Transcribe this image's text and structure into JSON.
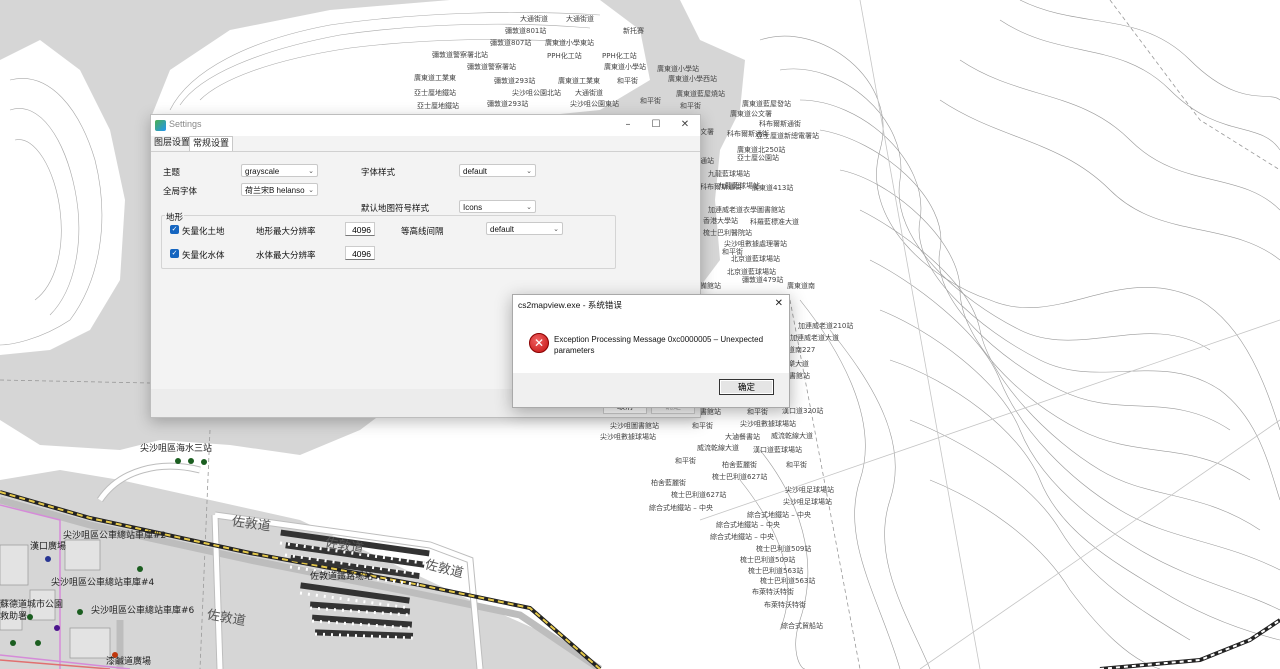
{
  "map": {
    "labels_top": [
      "大通街道",
      "大通街道",
      "彌敦道801站",
      "彌敦道807站",
      "廣東道小學東站",
      "新托賽",
      "彌敦道警察署北站",
      "PPH化工站",
      "彌敦道警察署站",
      "PPH化工站",
      "廣東道小學站",
      "廣東道小學站",
      "廣東道工業東",
      "彌敦道293站",
      "廣東道工業東",
      "和平街",
      "廣東道小學西站",
      "亞士厘地鐵站",
      "尖沙咀公園北站",
      "大通街道",
      "廣東道藍屋燒站",
      "亞士厘地鐵站",
      "彌敦道293站",
      "尖沙咀公園東站",
      "和平街",
      "和平街",
      "廣東道藍屋發站",
      "綜合式地鐵站",
      "中央"
    ],
    "labels_right": [
      "廣東道公文署",
      "科布爾斯通街",
      "文署",
      "科布爾斯通街",
      "亞士厘道新總電署站",
      "廣東道北250站",
      "亞士厘公園站",
      "通站",
      "九龍藍球場站",
      "九龍藍球場站",
      "科布爾斯通街",
      "廣東道413站",
      "加連威老道衣學圖書館站",
      "香港大學站",
      "科羅藍標准大道",
      "梳士巴利醫院站",
      "尖沙咀數據處理署站",
      "和平街",
      "北京道藍球場站",
      "北京道藍球場站",
      "彌敦道479站",
      "廣東道南",
      "備館站",
      "加連威老道210站",
      "加連威老道大道",
      "道南227",
      "樂大道",
      "書館站"
    ],
    "labels_bottom": [
      "書館站",
      "和平街",
      "漢口道320站",
      "尖沙咀圖書館站",
      "和平街",
      "尖沙咀數據球場站",
      "尖沙咀數據球場站",
      "大滷餐書站",
      "威流乾線大道",
      "威流乾線大道",
      "漢口道藍球場站",
      "和平街",
      "柏舍藍麗街",
      "和平街",
      "梳士巴利道627站",
      "尖沙咀足球場站",
      "柏舍藍麗街",
      "梳士巴利道627站",
      "尖沙咀足球場站",
      "綜合式地鐵站 – 中央",
      "綜合式地鐵站 – 中央",
      "綜合式地鐵站 – 中央",
      "綜合式地鐵站 – 中央",
      "梳士巴利道509站",
      "梳士巴利道509站",
      "梳士巴利道563站",
      "梳士巴利道563站",
      "布萊特沃特街",
      "布萊特沃特街",
      "綜合式貿船站"
    ],
    "labels_bottom_left": [
      "尖沙咀區海水三站",
      "尖沙咀區公車總站車庫#2",
      "漢口廣場",
      "尖沙咀區公車總站車庫#4",
      "蘇德道城市公園",
      "救助署",
      "尖沙咀區公車總站車庫#6",
      "漆鹹道廣場",
      "佐敦道鐵路場站"
    ],
    "road_labels": [
      "佐敦道",
      "佐敦道",
      "佐敦道",
      "佐敦道"
    ]
  },
  "settings": {
    "title": "Settings",
    "tabs": [
      "图层设置",
      "常规设置"
    ],
    "active_tab": "常规设置",
    "theme_label": "主题",
    "theme_value": "grayscale",
    "global_font_label": "全局字体",
    "global_font_value": "荷兰宋B helanso",
    "font_style_label": "字体样式",
    "font_style_value": "default",
    "default_symbol_label": "默认地图符号样式",
    "default_symbol_value": "Icons",
    "terrain_group": "地形",
    "vector_land_label": "矢量化土地",
    "terrain_res_label": "地形最大分辨率",
    "terrain_res_value": "4096",
    "contour_label": "等高线间隔",
    "contour_value": "default",
    "vector_water_label": "矢量化水体",
    "water_res_label": "水体最大分辨率",
    "water_res_value": "4096",
    "footer_btn1": "取消",
    "footer_btn2": "确定"
  },
  "error_dialog": {
    "title": "cs2mapview.exe - 系统错误",
    "message": "Exception Processing Message 0xc0000005 – Unexpected parameters",
    "ok": "确定"
  },
  "colors": {
    "water": "#d6d6d6",
    "land": "#ffffff",
    "accent_checkbox": "#1565c0",
    "error_red": "#c21010"
  }
}
